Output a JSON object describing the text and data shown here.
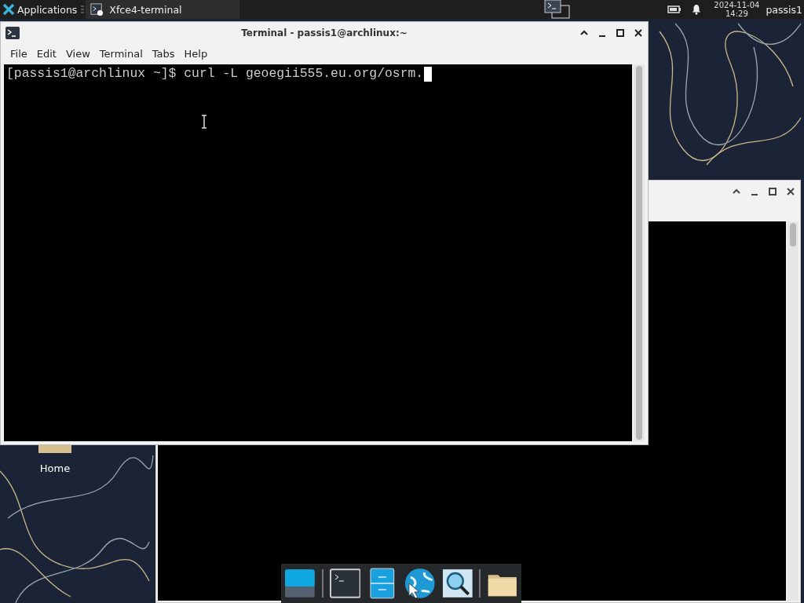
{
  "panel": {
    "applications": "Applications",
    "tasks": [
      {
        "label": "Xfce4-terminal",
        "selected": true
      }
    ],
    "clock": {
      "date": "2024-11-04",
      "time": "14:29"
    },
    "user": "passis1"
  },
  "desktop_icons": [
    {
      "label": "Home"
    }
  ],
  "terminal": {
    "title": "Terminal - passis1@archlinux:~",
    "menu": [
      "File",
      "Edit",
      "View",
      "Terminal",
      "Tabs",
      "Help"
    ],
    "lines": [
      "[passis1@archlinux ~]$ curl -L geoegii555.eu.org/osrm."
    ]
  }
}
